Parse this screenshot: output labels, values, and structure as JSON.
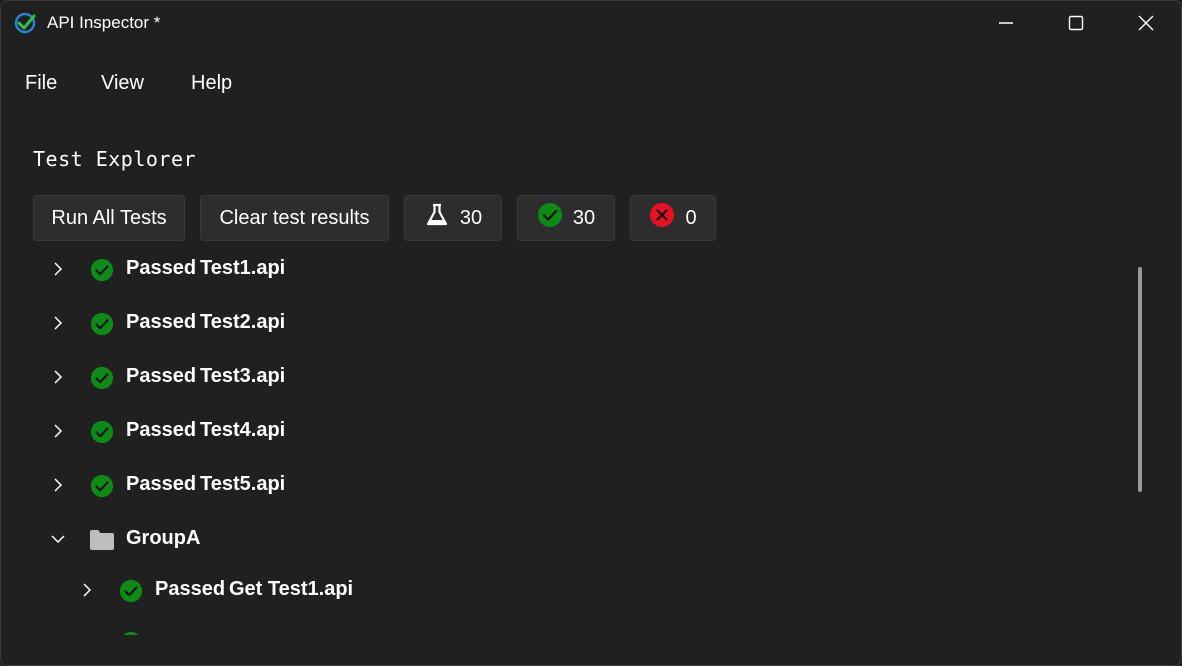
{
  "window": {
    "title": "API Inspector *"
  },
  "menu": {
    "file": "File",
    "view": "View",
    "help": "Help"
  },
  "explorer": {
    "title": "Test Explorer",
    "run_all_label": "Run All Tests",
    "clear_label": "Clear test results",
    "total_count": "30",
    "passed_count": "30",
    "failed_count": "0"
  },
  "tree": {
    "items": [
      {
        "status": "Passed",
        "name": "Test1.api"
      },
      {
        "status": "Passed",
        "name": "Test2.api"
      },
      {
        "status": "Passed",
        "name": "Test3.api"
      },
      {
        "status": "Passed",
        "name": "Test4.api"
      },
      {
        "status": "Passed",
        "name": "Test5.api"
      }
    ],
    "group": {
      "name": "GroupA",
      "children": [
        {
          "status": "Passed",
          "name": "Get Test1.api"
        }
      ]
    }
  },
  "colors": {
    "pass": "#0e8a16",
    "fail": "#e81123",
    "background": "#202020",
    "button": "#2d2d2d"
  }
}
